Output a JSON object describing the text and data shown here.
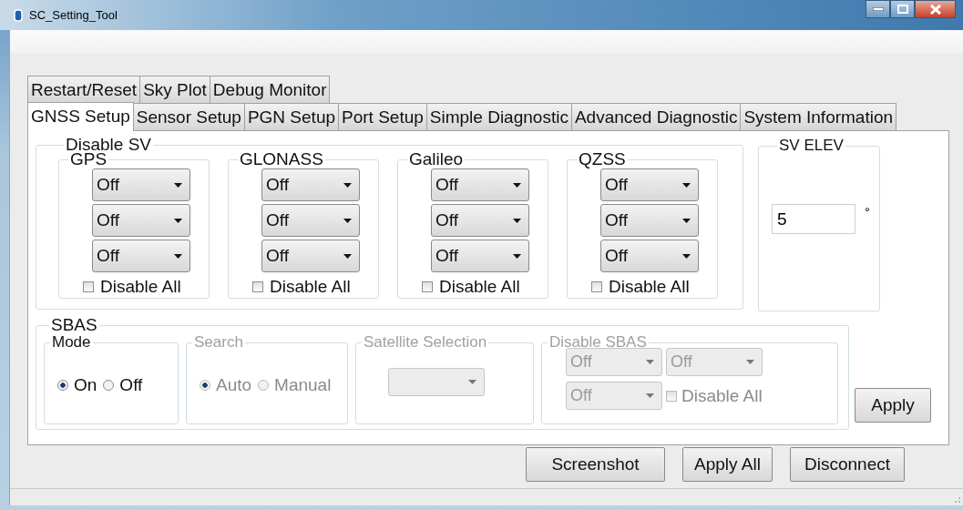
{
  "window": {
    "title": "SC_Setting_Tool"
  },
  "tab_rows": [
    [
      {
        "label": "Restart/Reset",
        "selected": false
      },
      {
        "label": "Sky Plot",
        "selected": false
      },
      {
        "label": "Debug Monitor",
        "selected": false
      }
    ],
    [
      {
        "label": "GNSS Setup",
        "selected": true
      },
      {
        "label": "Sensor Setup",
        "selected": false
      },
      {
        "label": "PGN Setup",
        "selected": false
      },
      {
        "label": "Port Setup",
        "selected": false
      },
      {
        "label": "Simple Diagnostic",
        "selected": false
      },
      {
        "label": "Advanced Diagnostic",
        "selected": false
      },
      {
        "label": "System Information",
        "selected": false
      }
    ]
  ],
  "disable_sv": {
    "title": "Disable SV",
    "groups": [
      {
        "name": "GPS",
        "dropdowns": [
          "Off",
          "Off",
          "Off"
        ],
        "disable_all": {
          "label": "Disable All",
          "checked": false
        }
      },
      {
        "name": "GLONASS",
        "dropdowns": [
          "Off",
          "Off",
          "Off"
        ],
        "disable_all": {
          "label": "Disable All",
          "checked": false
        }
      },
      {
        "name": "Galileo",
        "dropdowns": [
          "Off",
          "Off",
          "Off"
        ],
        "disable_all": {
          "label": "Disable All",
          "checked": false
        }
      },
      {
        "name": "QZSS",
        "dropdowns": [
          "Off",
          "Off",
          "Off"
        ],
        "disable_all": {
          "label": "Disable All",
          "checked": false
        }
      }
    ]
  },
  "sv_elev": {
    "title": "SV ELEV",
    "value": "5",
    "unit": "°"
  },
  "sbas": {
    "title": "SBAS",
    "mode": {
      "title": "Mode",
      "disabled": false,
      "options": [
        {
          "label": "On",
          "selected": true
        },
        {
          "label": "Off",
          "selected": false
        }
      ]
    },
    "search": {
      "title": "Search",
      "disabled": true,
      "options": [
        {
          "label": "Auto",
          "selected": true
        },
        {
          "label": "Manual",
          "selected": false
        }
      ]
    },
    "satellite_selection": {
      "title": "Satellite Selection",
      "disabled": true
    },
    "disable_sbas": {
      "title": "Disable SBAS",
      "disabled": true,
      "dropdowns": [
        "Off",
        "Off",
        "Off"
      ],
      "disable_all": {
        "label": "Disable All",
        "checked": false
      }
    }
  },
  "apply_button": "Apply",
  "buttons": [
    "Screenshot",
    "Apply All",
    "Disconnect"
  ]
}
